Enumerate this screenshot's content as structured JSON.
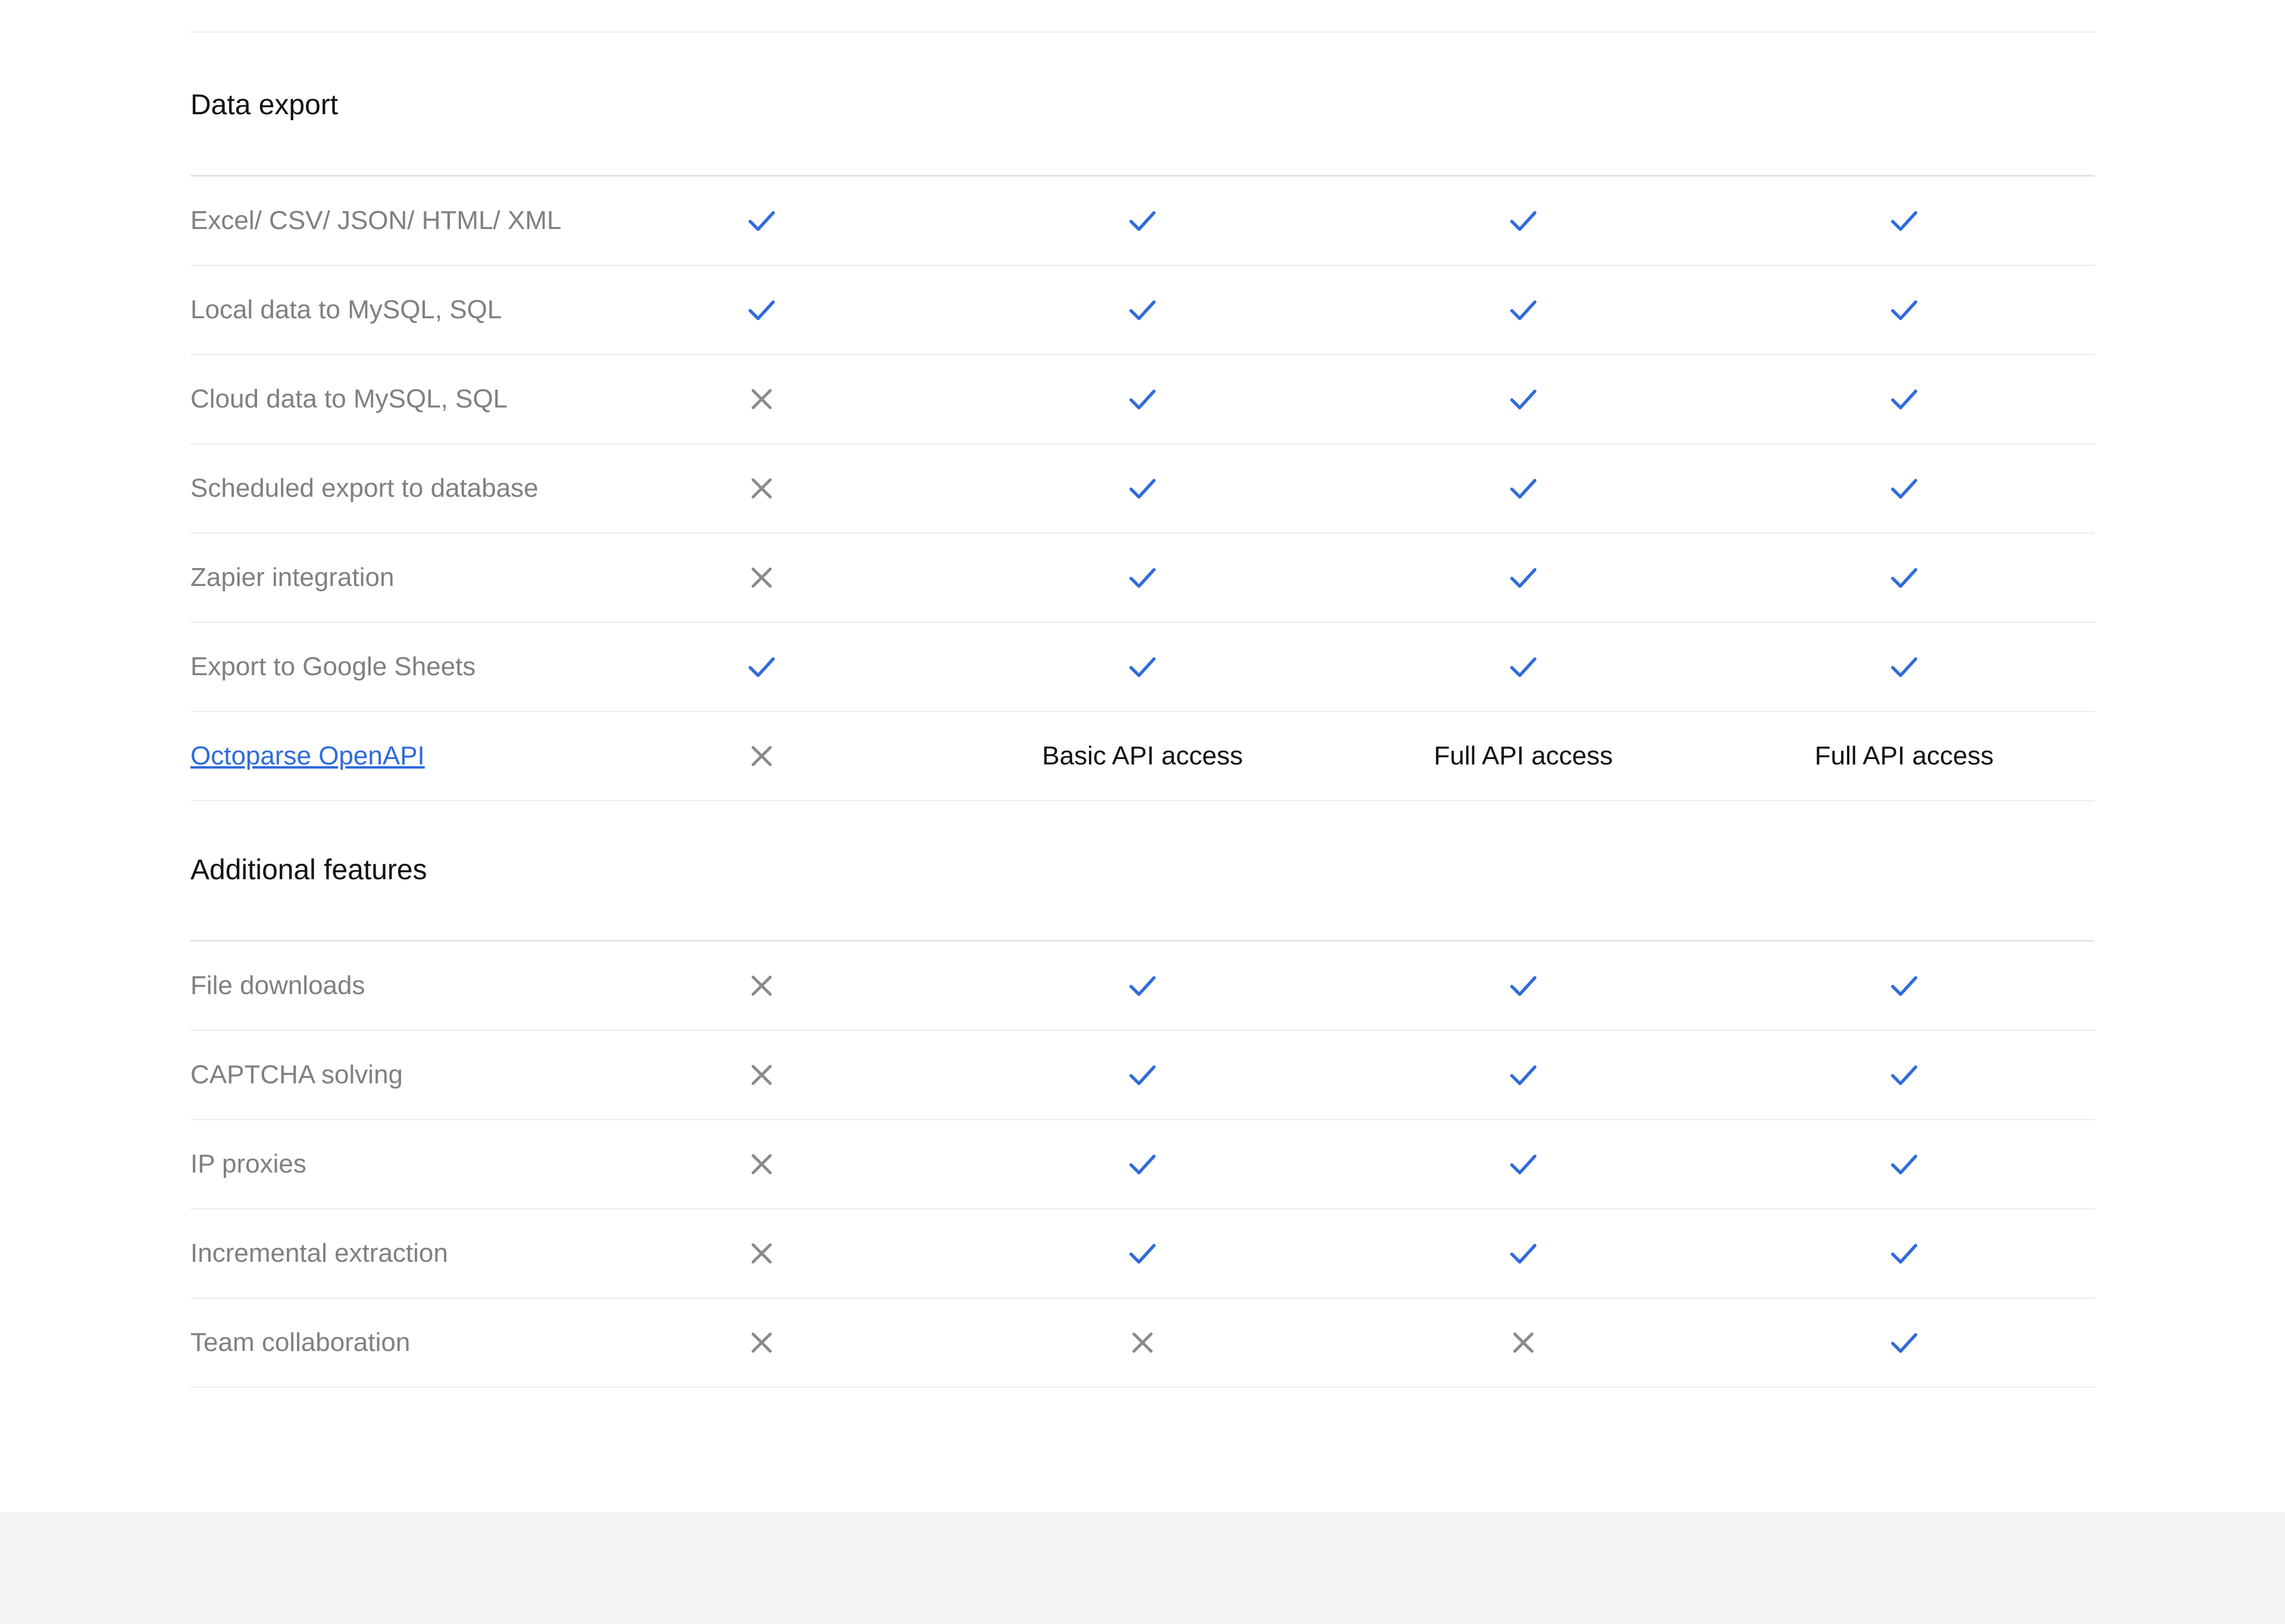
{
  "colors": {
    "check": "#2f6bdc",
    "cross": "#8a8a8a",
    "label": "#808080",
    "link": "#2f6bdc",
    "footer_bg": "#f4f4f4"
  },
  "icons": {
    "check": "check-icon",
    "cross": "cross-icon"
  },
  "sections": [
    {
      "title": "Data export",
      "rows": [
        {
          "feature": "Excel/ CSV/ JSON/ HTML/ XML",
          "link": false,
          "cells": [
            {
              "type": "check"
            },
            {
              "type": "check"
            },
            {
              "type": "check"
            },
            {
              "type": "check"
            }
          ]
        },
        {
          "feature": "Local data to MySQL, SQL",
          "link": false,
          "cells": [
            {
              "type": "check"
            },
            {
              "type": "check"
            },
            {
              "type": "check"
            },
            {
              "type": "check"
            }
          ]
        },
        {
          "feature": "Cloud data to MySQL, SQL",
          "link": false,
          "cells": [
            {
              "type": "cross"
            },
            {
              "type": "check"
            },
            {
              "type": "check"
            },
            {
              "type": "check"
            }
          ]
        },
        {
          "feature": "Scheduled export to database",
          "link": false,
          "cells": [
            {
              "type": "cross"
            },
            {
              "type": "check"
            },
            {
              "type": "check"
            },
            {
              "type": "check"
            }
          ]
        },
        {
          "feature": "Zapier integration",
          "link": false,
          "cells": [
            {
              "type": "cross"
            },
            {
              "type": "check"
            },
            {
              "type": "check"
            },
            {
              "type": "check"
            }
          ]
        },
        {
          "feature": "Export to Google Sheets",
          "link": false,
          "cells": [
            {
              "type": "check"
            },
            {
              "type": "check"
            },
            {
              "type": "check"
            },
            {
              "type": "check"
            }
          ]
        },
        {
          "feature": "Octoparse OpenAPI",
          "link": true,
          "cells": [
            {
              "type": "cross"
            },
            {
              "type": "text",
              "text": "Basic API access"
            },
            {
              "type": "text",
              "text": "Full API access"
            },
            {
              "type": "text",
              "text": "Full API access"
            }
          ]
        }
      ]
    },
    {
      "title": "Additional features",
      "rows": [
        {
          "feature": "File downloads",
          "link": false,
          "cells": [
            {
              "type": "cross"
            },
            {
              "type": "check"
            },
            {
              "type": "check"
            },
            {
              "type": "check"
            }
          ]
        },
        {
          "feature": "CAPTCHA solving",
          "link": false,
          "cells": [
            {
              "type": "cross"
            },
            {
              "type": "check"
            },
            {
              "type": "check"
            },
            {
              "type": "check"
            }
          ]
        },
        {
          "feature": "IP proxies",
          "link": false,
          "cells": [
            {
              "type": "cross"
            },
            {
              "type": "check"
            },
            {
              "type": "check"
            },
            {
              "type": "check"
            }
          ]
        },
        {
          "feature": "Incremental extraction",
          "link": false,
          "cells": [
            {
              "type": "cross"
            },
            {
              "type": "check"
            },
            {
              "type": "check"
            },
            {
              "type": "check"
            }
          ]
        },
        {
          "feature": "Team collaboration",
          "link": false,
          "cells": [
            {
              "type": "cross"
            },
            {
              "type": "cross"
            },
            {
              "type": "cross"
            },
            {
              "type": "check"
            }
          ]
        }
      ]
    }
  ]
}
